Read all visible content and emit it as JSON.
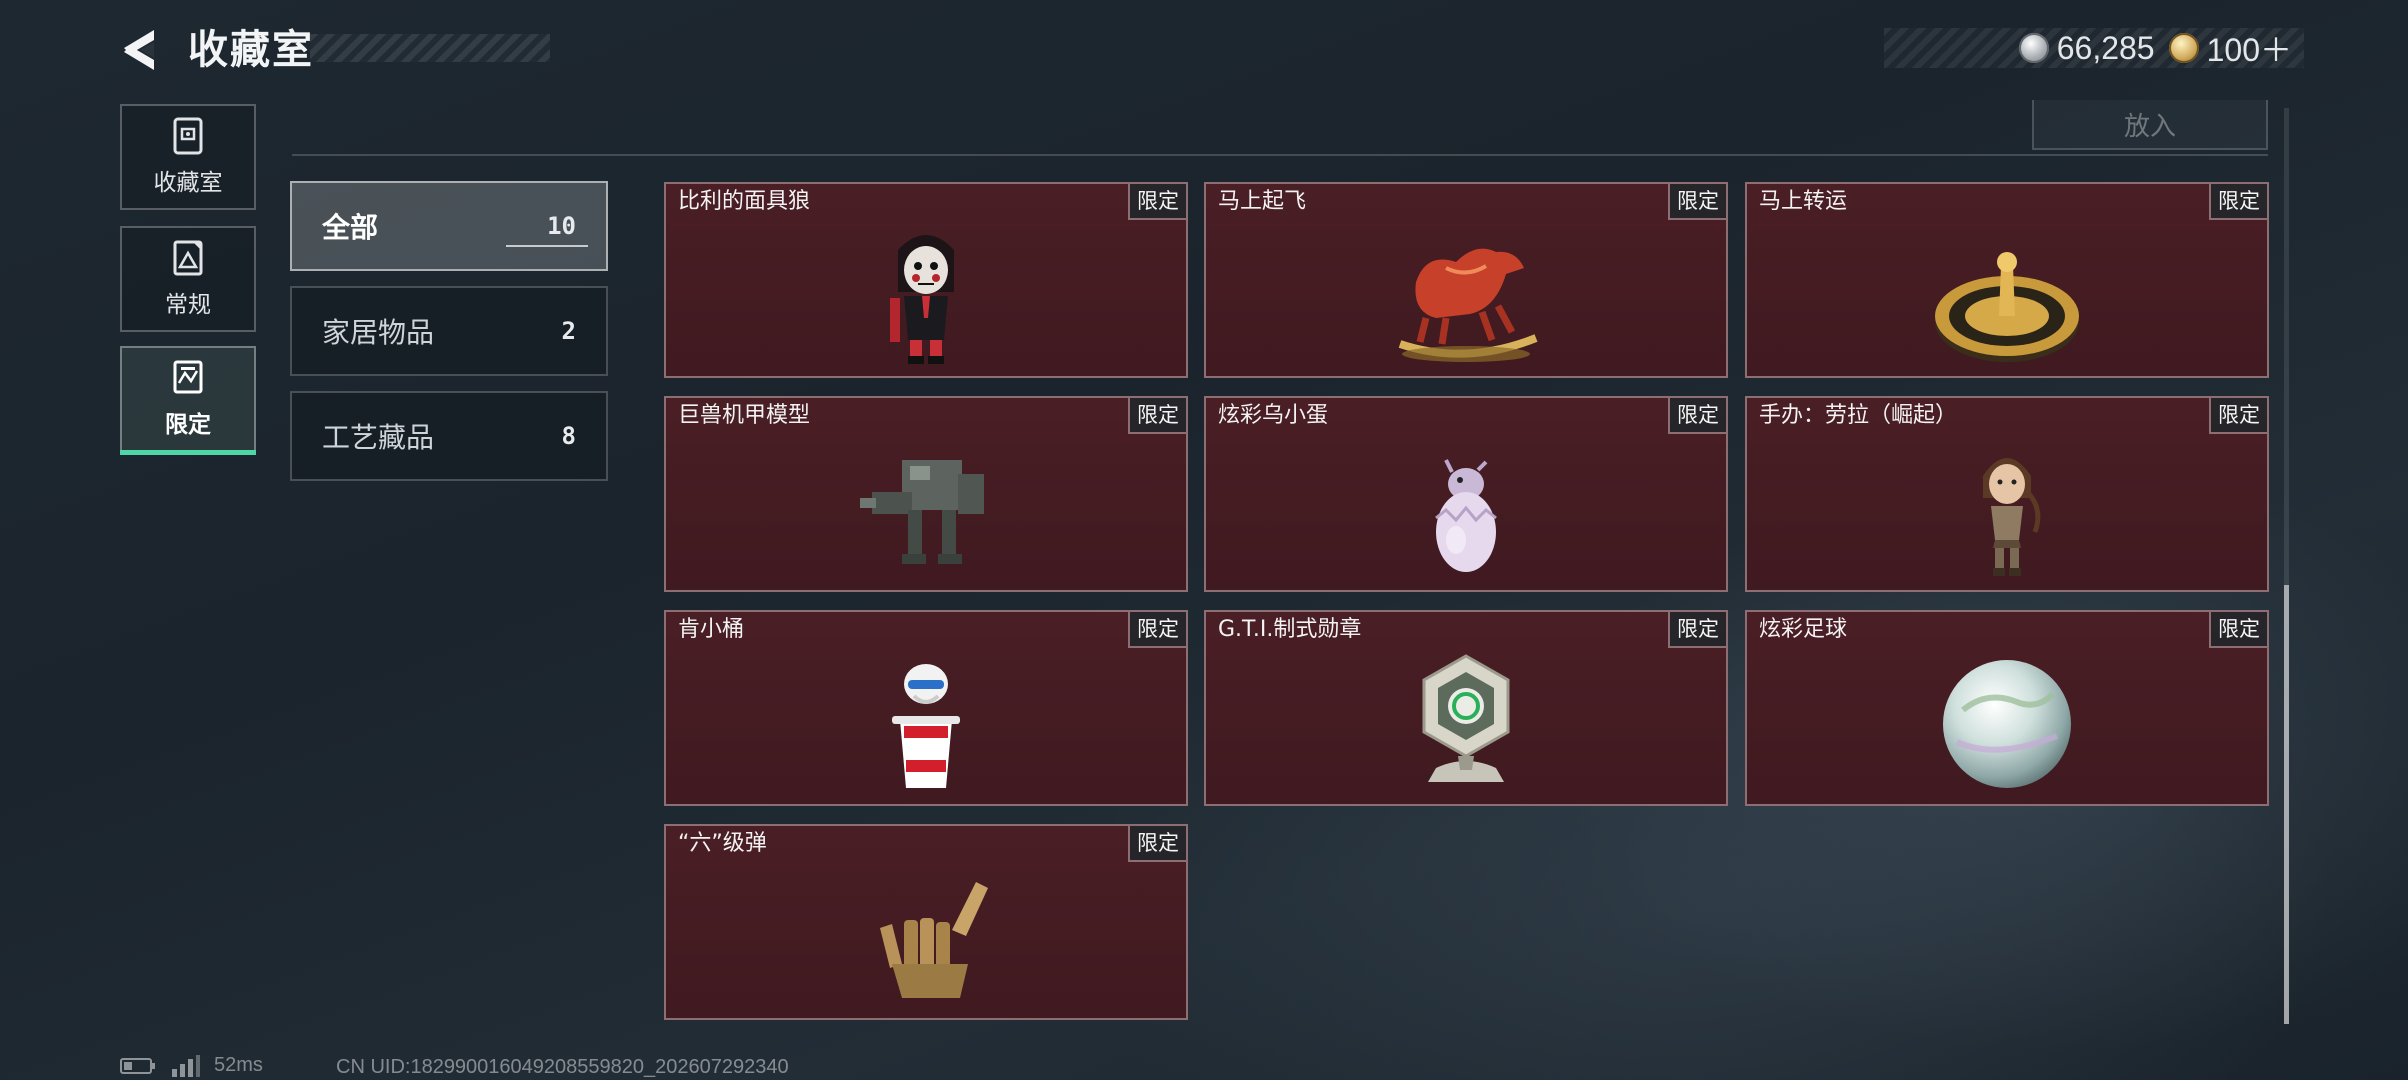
{
  "header": {
    "title": "收藏室",
    "currencies": [
      {
        "icon": "silver-coin-icon",
        "value": "66,285"
      },
      {
        "icon": "gold-coin-icon",
        "value": "100＋"
      }
    ]
  },
  "nav": [
    {
      "label": "收藏室",
      "icon": "cabinet-icon",
      "active": false
    },
    {
      "label": "常规",
      "icon": "picture-frame-icon",
      "active": false
    },
    {
      "label": "限定",
      "icon": "limited-frame-icon",
      "active": true
    }
  ],
  "toolbar": {
    "place_label": "放入"
  },
  "categories": [
    {
      "label": "全部",
      "count": "10",
      "active": true
    },
    {
      "label": "家居物品",
      "count": "2",
      "active": false
    },
    {
      "label": "工艺藏品",
      "count": "8",
      "active": false
    }
  ],
  "items": [
    {
      "name": "比利的面具狼",
      "badge": "限定",
      "icon": "puppet-figure-icon"
    },
    {
      "name": "马上起飞",
      "badge": "限定",
      "icon": "rocking-horse-icon"
    },
    {
      "name": "马上转运",
      "badge": "限定",
      "icon": "golden-wheel-icon"
    },
    {
      "name": "巨兽机甲模型",
      "badge": "限定",
      "icon": "mech-model-icon"
    },
    {
      "name": "炫彩乌小蛋",
      "badge": "限定",
      "icon": "hatching-egg-icon"
    },
    {
      "name": "手办：劳拉（崛起）",
      "badge": "限定",
      "icon": "lara-figure-icon"
    },
    {
      "name": "肯小桶",
      "badge": "限定",
      "icon": "bucket-figure-icon"
    },
    {
      "name": "G.T.I.制式勋章",
      "badge": "限定",
      "icon": "gti-medal-icon"
    },
    {
      "name": "炫彩足球",
      "badge": "限定",
      "icon": "iridescent-ball-icon"
    },
    {
      "name": "“六”级弹",
      "badge": "限定",
      "icon": "golden-hand-icon"
    }
  ],
  "status": {
    "ping": "52ms",
    "uid": "CN UID:18299001604920855982­0_202607292340"
  },
  "colors": {
    "accent": "#4fd6a6",
    "card_bg": "#4a1e25",
    "card_border": "#8d6e73"
  }
}
